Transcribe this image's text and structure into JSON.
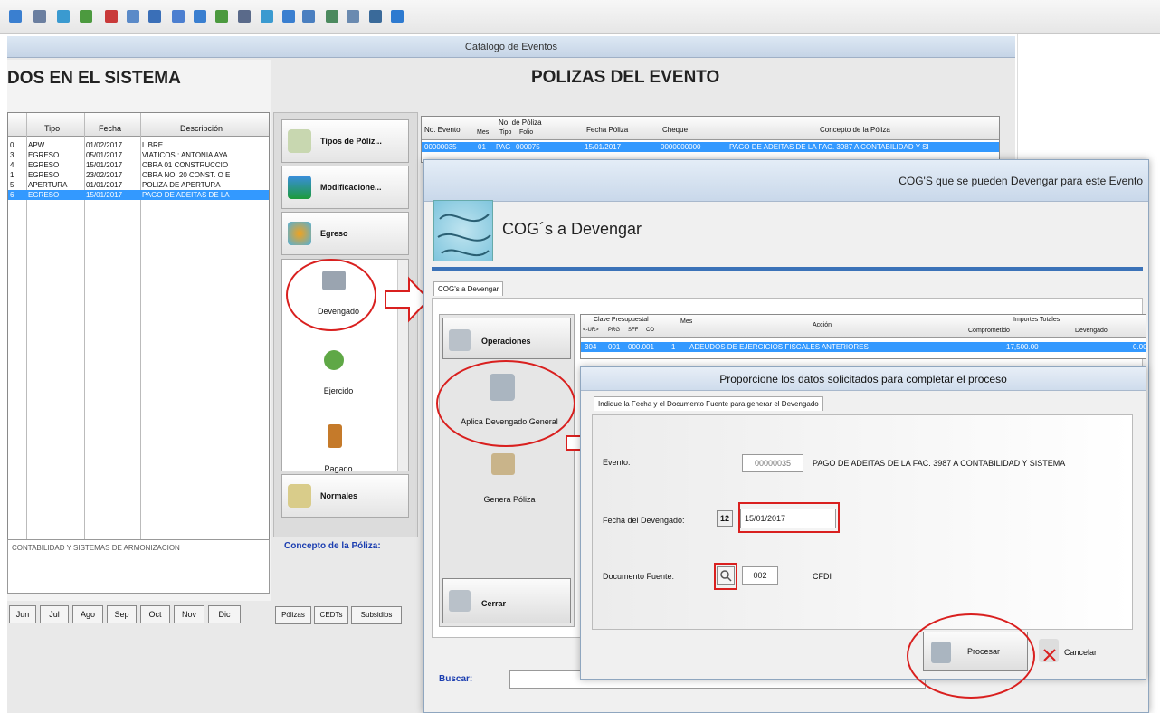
{
  "window": {
    "title": "Catálogo de Eventos"
  },
  "toolbar": {
    "icons": [
      "grid-icon",
      "list-icon",
      "filter-icon",
      "chart-icon",
      "delete-icon",
      "bottle-icon",
      "save-icon",
      "edit-icon",
      "pin-icon",
      "leaf-icon",
      "cursor-icon",
      "doc-icon",
      "doc2-icon",
      "monitor-icon",
      "refresh-icon",
      "copy-icon",
      "table-icon",
      "info-icon"
    ]
  },
  "left": {
    "title": "DOS EN EL SISTEMA",
    "headers": [
      "",
      "Tipo",
      "Fecha",
      "Descripción"
    ],
    "rows": [
      [
        "0",
        "APW",
        "01/02/2017",
        "LIBRE"
      ],
      [
        "3",
        "EGRESO",
        "05/01/2017",
        "VIATICOS : ANTONIA AYA"
      ],
      [
        "4",
        "EGRESO",
        "15/01/2017",
        "OBRA 01 CONSTRUCCIO"
      ],
      [
        "1",
        "EGRESO",
        "23/02/2017",
        "OBRA NO. 20 CONST. O E"
      ],
      [
        "5",
        "APERTURA",
        "01/01/2017",
        "POLIZA DE APERTURA"
      ],
      [
        "6",
        "EGRESO",
        "15/01/2017",
        "PAGO DE ADEITAS DE LA"
      ]
    ],
    "description_text": "CONTABILIDAD Y SISTEMAS DE ARMONIZACION",
    "month_tabs": [
      "Jun",
      "Jul",
      "Ago",
      "Sep",
      "Oct",
      "Nov",
      "Dic"
    ]
  },
  "middle": {
    "title": "POLIZAS DEL EVENTO",
    "side_buttons": [
      "Tipos de Póliz...",
      "Modificacione...",
      "Egreso",
      "Normales"
    ],
    "scroll_items": [
      "Devengado",
      "Ejercido",
      "Pagado"
    ],
    "concepto_label": "Concepto de la Póliza:",
    "bottom_tabs": [
      "Pólizas",
      "CEDTs",
      "Subsidios"
    ],
    "poliza_headers": [
      "No. Evento",
      "No. de Póliza",
      "Mes",
      "Tipo",
      "Folio",
      "Fecha Póliza",
      "Cheque",
      "Concepto de la Póliza"
    ],
    "poliza_row": [
      "00000035",
      "01",
      "PAG",
      "000075",
      "15/01/2017",
      "0000000000",
      "PAGO DE ADEITAS DE LA FAC. 3987 A CONTABILIDAD Y SI"
    ]
  },
  "dialog": {
    "title": "COG'S que se pueden Devengar para este Evento",
    "header_label": "COG´s a Devengar",
    "tab": "COG's a Devengar",
    "left_buttons": [
      "Operaciones",
      "Aplica Devengado General",
      "Genera Póliza",
      "Cerrar"
    ],
    "grid_headers": {
      "clave": "Clave Presupuestal",
      "sub": [
        "<-UR>",
        "PRG",
        "SFF",
        "CO"
      ],
      "mes": "Mes",
      "accion": "Acción",
      "importes": "Importes Totales",
      "comprometido": "Comprometido",
      "devengado": "Devengado"
    },
    "grid_row": [
      "304",
      "001",
      "000.001",
      "1",
      "ADEUDOS DE EJERCICIOS FISCALES ANTERIORES",
      "17,500.00",
      "0.00"
    ],
    "buscar_label": "Buscar:"
  },
  "dialog2": {
    "title": "Proporcione los datos solicitados para completar el proceso",
    "tab": "Indique la Fecha y el Documento Fuente para generar el Devengado",
    "evento_label": "Evento:",
    "evento_value": "00000035",
    "evento_desc": "PAGO DE ADEITAS DE LA FAC. 3987 A CONTABILIDAD Y SISTEMA",
    "fecha_label": "Fecha del Devengado:",
    "fecha_value": "15/01/2017",
    "calendar_text": "12",
    "doc_label": "Documento Fuente:",
    "doc_value": "002",
    "doc_type": "CFDI",
    "procesar": "Procesar",
    "cancelar": "Cancelar"
  }
}
